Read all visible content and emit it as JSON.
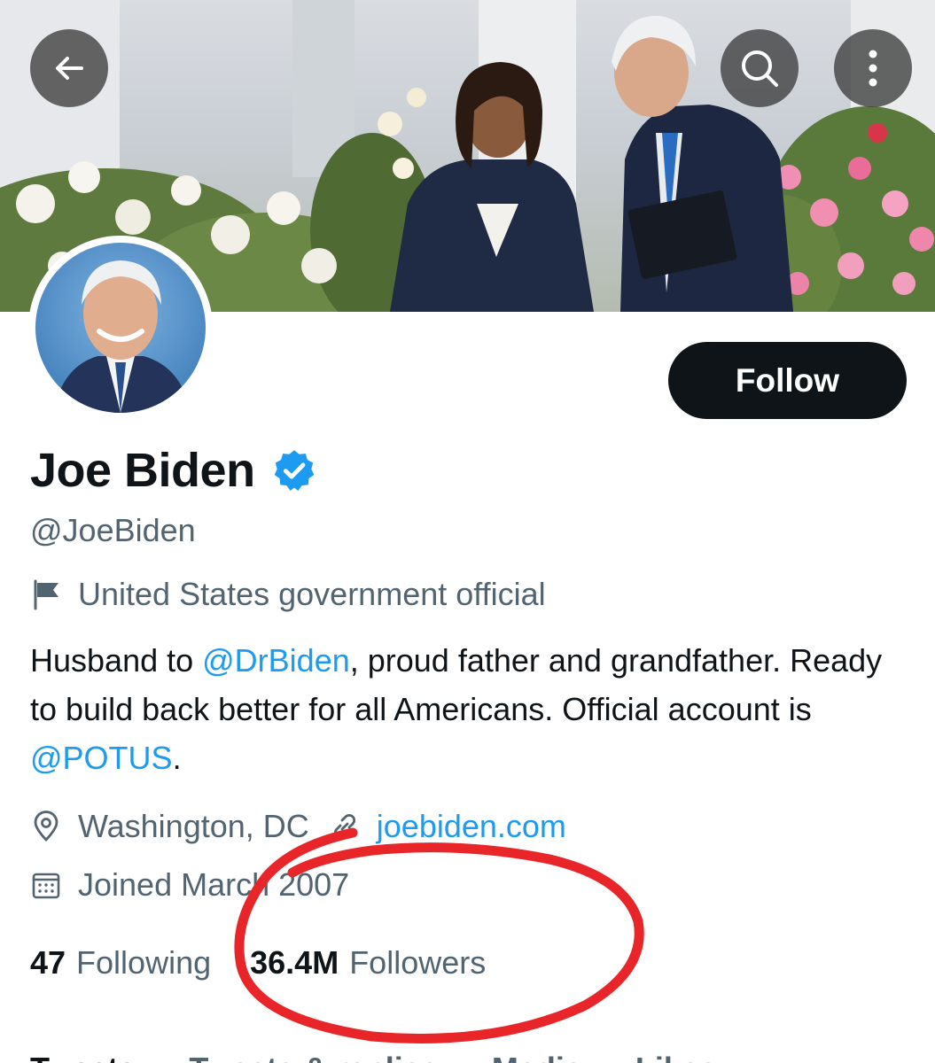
{
  "header": {
    "back_icon": "arrow-left-icon",
    "search_icon": "search-icon",
    "more_icon": "more-vertical-icon"
  },
  "profile": {
    "display_name": "Joe Biden",
    "verified_icon": "verified-badge-icon",
    "handle": "@JoeBiden",
    "category": "United States government official",
    "bio": {
      "part1": "Husband to ",
      "mention1": "@DrBiden",
      "part2": ", proud father and grandfather. Ready to build back better for all Americans. Official account is ",
      "mention2": "@POTUS",
      "part3": "."
    },
    "location": "Washington, DC",
    "website": "joebiden.com",
    "joined": "Joined March 2007"
  },
  "stats": {
    "following_count": "47",
    "following_label": "Following",
    "followers_count": "36.4M",
    "followers_label": "Followers"
  },
  "actions": {
    "follow_label": "Follow"
  },
  "tabs": [
    {
      "label": "Tweets"
    },
    {
      "label": "Tweets & replies"
    },
    {
      "label": "Media"
    },
    {
      "label": "Likes"
    }
  ],
  "colors": {
    "accent": "#1d9bf0",
    "annotation": "#e8262a",
    "text_primary": "#0f1419",
    "text_secondary": "#536471"
  }
}
